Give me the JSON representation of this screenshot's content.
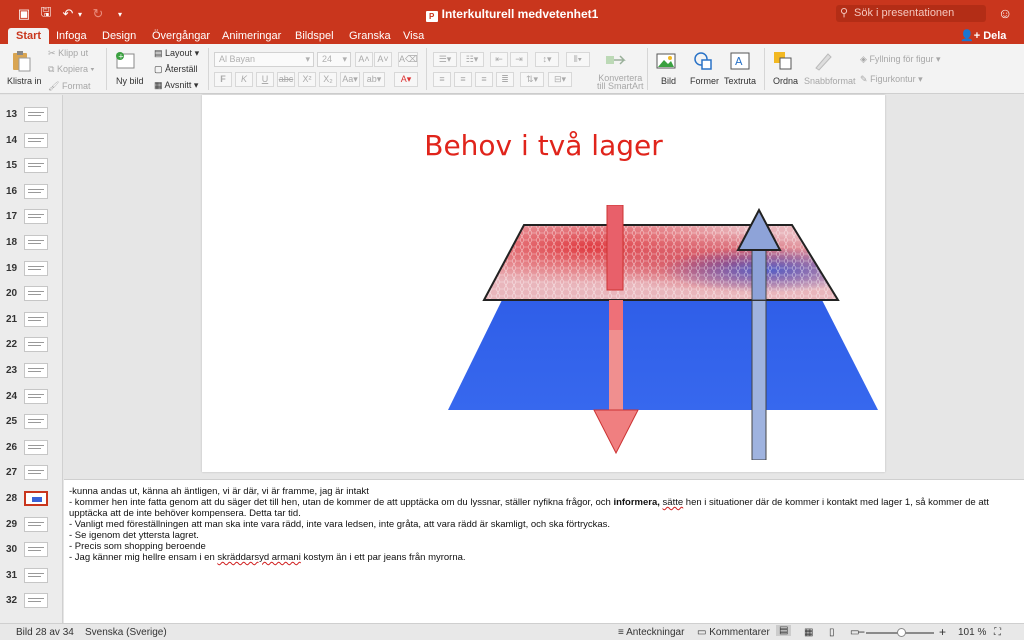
{
  "app": {
    "title": "Interkulturell medvetenhet1",
    "search_placeholder": "Sök i presentationen",
    "share_label": "Dela"
  },
  "tabs": [
    {
      "label": "Start",
      "active": true
    },
    {
      "label": "Infoga"
    },
    {
      "label": "Design"
    },
    {
      "label": "Övergångar"
    },
    {
      "label": "Animeringar"
    },
    {
      "label": "Bildspel"
    },
    {
      "label": "Granska"
    },
    {
      "label": "Visa"
    }
  ],
  "ribbon": {
    "paste": "Klistra in",
    "cut": "Klipp ut",
    "copy": "Kopiera",
    "format": "Format",
    "new_slide": "Ny bild",
    "layout": "Layout",
    "reset": "Återställ",
    "section": "Avsnitt",
    "font_name": "Al Bayan",
    "font_size": "24",
    "convert_smartart_1": "Konvertera",
    "convert_smartart_2": "till SmartArt",
    "picture": "Bild",
    "shapes": "Former",
    "textbox": "Textruta",
    "arrange": "Ordna",
    "quick_styles": "Snabbformat",
    "shape_fill": "Fyllning för figur",
    "shape_outline": "Figurkontur"
  },
  "thumbnails": {
    "numbers": [
      "13",
      "14",
      "15",
      "16",
      "17",
      "18",
      "19",
      "20",
      "21",
      "22",
      "23",
      "24",
      "25",
      "26",
      "27",
      "28",
      "29",
      "30",
      "31",
      "32"
    ],
    "selected": "28"
  },
  "slide": {
    "title": "Behov i två lager"
  },
  "notes": {
    "line1": "-kunna andas ut, känna ah äntligen, vi är där, vi är framme, jag är intakt",
    "line2_a": "- kommer hen inte fatta genom att du säger det till hen, utan de kommer de att upptäcka om du lyssnar, ställer nyfikna frågor, och ",
    "line2_bold": "informera,",
    "line2_squig": "sätte",
    "line2_b": " hen i situationer där de kommer i kontakt med lager 1, så kommer de att upptäcka att de inte behöver kompensera. Detta tar tid.",
    "line3": "-   Vanligt med föreställningen att man ska inte vara rädd, inte vara ledsen, inte gråta, att vara rädd är skamligt, och ska förtryckas.",
    "line4": "-   Se igenom det yttersta lagret.",
    "line5": "-   Precis som shopping beroende",
    "line6_a": "-   Jag känner mig hellre ensam i en ",
    "line6_squig": "skräddarsyd armani",
    "line6_b": " kostym än i ett par jeans från myrorna."
  },
  "status": {
    "slide_counter": "Bild 28 av 34",
    "language": "Svenska (Sverige)",
    "notes_btn": "Anteckningar",
    "comments_btn": "Kommentarer",
    "zoom": "101 %"
  },
  "colors": {
    "brand": "#c9361d",
    "title_red": "#e0241b",
    "layer_blue": "#2f5ee8"
  }
}
